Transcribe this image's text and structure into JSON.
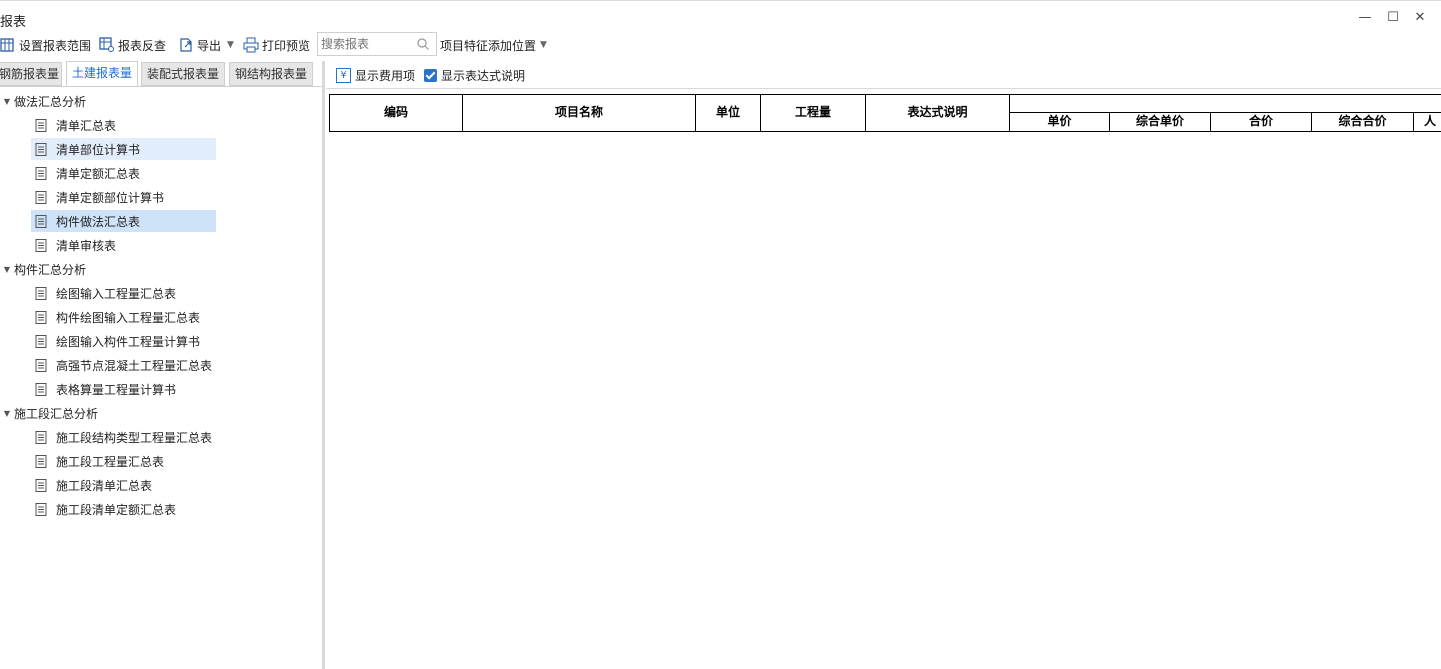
{
  "window": {
    "title": "报表",
    "minimize": "—",
    "maximize": "☐",
    "close": "✕"
  },
  "toolbar": {
    "set_range": "设置报表范围",
    "reverse_check": "报表反查",
    "export": "导出",
    "print_preview": "打印预览",
    "search_placeholder": "搜索报表",
    "feature_position": "项目特征添加位置"
  },
  "tabs": [
    "钢筋报表量",
    "土建报表量",
    "装配式报表量",
    "钢结构报表量"
  ],
  "active_tab": "土建报表量",
  "tree": {
    "groups": [
      {
        "label": "做法汇总分析",
        "items": [
          "清单汇总表",
          "清单部位计算书",
          "清单定额汇总表",
          "清单定额部位计算书",
          "构件做法汇总表",
          "清单审核表"
        ]
      },
      {
        "label": "构件汇总分析",
        "items": [
          "绘图输入工程量汇总表",
          "构件绘图输入工程量汇总表",
          "绘图输入构件工程量计算书",
          "高强节点混凝土工程量汇总表",
          "表格算量工程量计算书"
        ]
      },
      {
        "label": "施工段汇总分析",
        "items": [
          "施工段结构类型工程量汇总表",
          "施工段工程量汇总表",
          "施工段清单汇总表",
          "施工段清单定额汇总表"
        ]
      }
    ],
    "selected_item": "构件做法汇总表",
    "hovered_item": "清单部位计算书"
  },
  "options": {
    "show_fee": "显示费用项",
    "show_expr": "显示表达式说明",
    "show_expr_checked": true
  },
  "table": {
    "headers": [
      "编码",
      "项目名称",
      "单位",
      "工程量",
      "表达式说明"
    ],
    "price_headers": [
      "单价",
      "综合单价",
      "合价",
      "综合合价",
      "人"
    ]
  },
  "colors": {
    "accent": "#1f6fd0",
    "selected_bg": "#cfe3f8",
    "hover_bg": "#e2eefb"
  }
}
